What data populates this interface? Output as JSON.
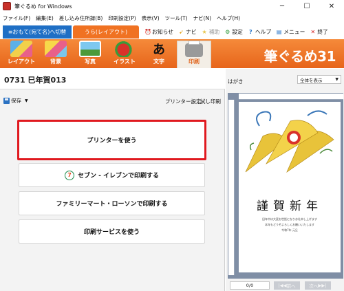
{
  "window": {
    "title": "筆ぐるめ for Windows"
  },
  "menubar": {
    "items": [
      "ファイル(F)",
      "編集(E)",
      "差し込み住所録(B)",
      "印刷設定(P)",
      "表示(V)",
      "ツール(T)",
      "ナビ(N)",
      "ヘルプ(H)"
    ]
  },
  "mode_tabs": {
    "switch_label": "≡おもて(宛て名)へ切替",
    "ura_label": "うら(レイアウト)"
  },
  "top_buttons": {
    "news": "お知らせ",
    "navi": "ナビ",
    "hokan": "補助",
    "settings": "設定",
    "help": "ヘルプ",
    "menu": "メニュー",
    "exit": "終了"
  },
  "toolbar": {
    "tools": [
      "レイアウト",
      "背景",
      "写真",
      "イラスト",
      "文字",
      "印刷"
    ],
    "active": "印刷",
    "logo": "筆ぐるめ31"
  },
  "document": {
    "title": "0731  巳年賀013"
  },
  "subbar": {
    "save_label": "保存",
    "printer_settings": "プリンター設定",
    "test_print": "試し印刷"
  },
  "print_options": {
    "use_printer": "プリンターを使う",
    "seven_eleven": "セブン - イレブンで印刷する",
    "familymart": "ファミリーマート・ローソンで印刷する",
    "print_service": "印刷サービスを使う"
  },
  "preview": {
    "paper_label": "はがき",
    "zoom_value": "全体を表示",
    "greeting": "謹賀新年",
    "line1": "旧年中は大変お世話になりお礼申し上げます",
    "line2": "本年もどうぞよろしくお願いいたします",
    "line3": "令和7年  元旦",
    "page_counter": "0/0",
    "prev_label": "前へ",
    "next_label": "次へ"
  },
  "colors": {
    "accent_orange": "#f07222",
    "switch_blue": "#1f6fc5",
    "selected_border": "#e0191f"
  }
}
